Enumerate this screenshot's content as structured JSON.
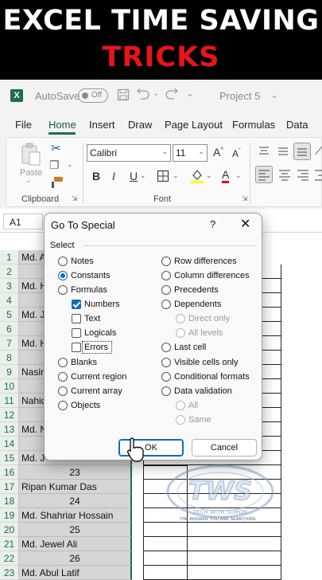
{
  "banner": {
    "line1": "EXCEL TIME SAVING",
    "line2": "TRICKS"
  },
  "titlebar": {
    "app_logo": "X",
    "autosave_label": "AutoSave",
    "toggle_label": "Off",
    "project_title": "Project 5",
    "icons": [
      "save-icon",
      "undo-icon",
      "redo-icon",
      "chevron-down-icon"
    ]
  },
  "tabs": [
    "File",
    "Home",
    "Insert",
    "Draw",
    "Page Layout",
    "Formulas",
    "Data"
  ],
  "active_tab": "Home",
  "ribbon": {
    "paste_label": "Paste",
    "clipboard_label": "Clipboard",
    "font_label": "Font",
    "font_name": "Calibri",
    "font_size": "11",
    "font_buttons": [
      "B",
      "I",
      "U"
    ],
    "grow_font": "A",
    "shrink_font": "A"
  },
  "name_box": "A1",
  "dialog": {
    "title": "Go To Special",
    "help": "?",
    "close": "✕",
    "group_label": "Select",
    "left_options": [
      {
        "label": "Notes",
        "type": "radio",
        "checked": false,
        "disabled": false
      },
      {
        "label": "Constants",
        "type": "radio",
        "checked": true,
        "disabled": false
      },
      {
        "label": "Formulas",
        "type": "radio",
        "checked": false,
        "disabled": false
      },
      {
        "label": "Numbers",
        "type": "check",
        "checked": true,
        "disabled": false
      },
      {
        "label": "Text",
        "type": "check",
        "checked": false,
        "disabled": false
      },
      {
        "label": "Logicals",
        "type": "check",
        "checked": false,
        "disabled": false
      },
      {
        "label": "Errors",
        "type": "check",
        "checked": false,
        "disabled": false
      },
      {
        "label": "Blanks",
        "type": "radio",
        "checked": false,
        "disabled": false
      },
      {
        "label": "Current region",
        "type": "radio",
        "checked": false,
        "disabled": false
      },
      {
        "label": "Current array",
        "type": "radio",
        "checked": false,
        "disabled": false
      },
      {
        "label": "Objects",
        "type": "radio",
        "checked": false,
        "disabled": false
      }
    ],
    "right_options": [
      {
        "label": "Row differences",
        "disabled": false
      },
      {
        "label": "Column differences",
        "disabled": false
      },
      {
        "label": "Precedents",
        "disabled": false
      },
      {
        "label": "Dependents",
        "disabled": false
      },
      {
        "label": "Direct only",
        "disabled": true
      },
      {
        "label": "All levels",
        "disabled": true
      },
      {
        "label": "Last cell",
        "disabled": false
      },
      {
        "label": "Visible cells only",
        "disabled": false
      },
      {
        "label": "Conditional formats",
        "disabled": false
      },
      {
        "label": "Data validation",
        "disabled": false
      },
      {
        "label": "All",
        "disabled": true
      },
      {
        "label": "Same",
        "disabled": true
      }
    ],
    "ok_label": "OK",
    "cancel_label": "Cancel"
  },
  "rows": [
    {
      "num": "1",
      "a": "Md. A",
      "center": false
    },
    {
      "num": "2",
      "a": "",
      "center": false
    },
    {
      "num": "3",
      "a": "Md. H",
      "center": false
    },
    {
      "num": "4",
      "a": "",
      "center": false
    },
    {
      "num": "5",
      "a": "Md. J",
      "center": false
    },
    {
      "num": "6",
      "a": "",
      "center": false
    },
    {
      "num": "7",
      "a": "Md. H",
      "center": false
    },
    {
      "num": "8",
      "a": "",
      "center": false
    },
    {
      "num": "9",
      "a": "Nasim",
      "center": false
    },
    {
      "num": "10",
      "a": "",
      "center": false
    },
    {
      "num": "11",
      "a": "Nahid",
      "center": false
    },
    {
      "num": "12",
      "a": "",
      "center": false
    },
    {
      "num": "13",
      "a": "Md. N",
      "center": false
    },
    {
      "num": "14",
      "a": "",
      "center": false
    },
    {
      "num": "15",
      "a": "Md. J",
      "center": false
    },
    {
      "num": "16",
      "a": "23",
      "center": true
    },
    {
      "num": "17",
      "a": "Ripan Kumar Das",
      "center": false
    },
    {
      "num": "18",
      "a": "24",
      "center": true
    },
    {
      "num": "19",
      "a": "Md. Shahriar Hossain",
      "center": false
    },
    {
      "num": "20",
      "a": "25",
      "center": true
    },
    {
      "num": "21",
      "a": "Md. Jewel Ali",
      "center": false
    },
    {
      "num": "22",
      "a": "26",
      "center": true
    },
    {
      "num": "23",
      "a": "Md. Abul Latif",
      "center": false
    }
  ],
  "watermark": {
    "line1": "TECH WITH SUMON",
    "line2": "THE ANSWER YOU ARE SEARCHING",
    "logo": "TWS"
  }
}
